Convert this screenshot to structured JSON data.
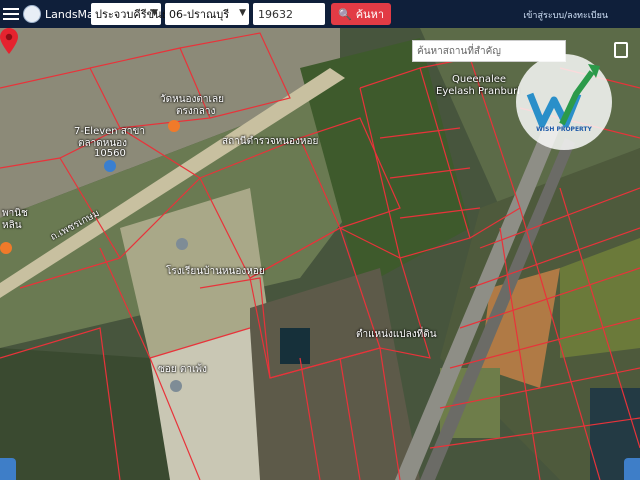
{
  "app": {
    "brand": "LandsMaps"
  },
  "toolbar": {
    "province": "ประจวบคีรีขันธ์",
    "district": "06-ปราณบุรี",
    "parcel_no": "19632",
    "search_label": "ค้นหา",
    "login_text": "เข้าสู่ระบบ/ลงทะเบียน"
  },
  "map": {
    "place_search_placeholder": "ค้นหาสถานที่สำคัญ",
    "labels": {
      "queenalee": "Queenalee",
      "eyelash": "Eyelash Pranburi",
      "seven_eleven": "7-Eleven สาขา",
      "seven_eleven_branch": "ตลาดหนอง",
      "seven_eleven_code": "10560",
      "temple_top": "วัดหนองตาเลย",
      "temple_top2": "ตรงกลาง",
      "school_label": "สถานีตำรวจหนองหอย",
      "road_name": "ถ.เพชรเกษม",
      "school2": "โรงเรียนบ้านหนองหอย",
      "left_label": "พานิช",
      "left_label2": "หลิน",
      "parcel_caption": "ตำแหน่งแปลงที่ดิน",
      "bottom_label": "ซอย ตาเพ้ง"
    },
    "watermark": {
      "text": "WISH PROPERTY"
    },
    "colors": {
      "parcel_lines": "#e8333a",
      "pin": "#e5232f",
      "accent": "#e23b45",
      "topbar": "#0f1f3a"
    }
  }
}
